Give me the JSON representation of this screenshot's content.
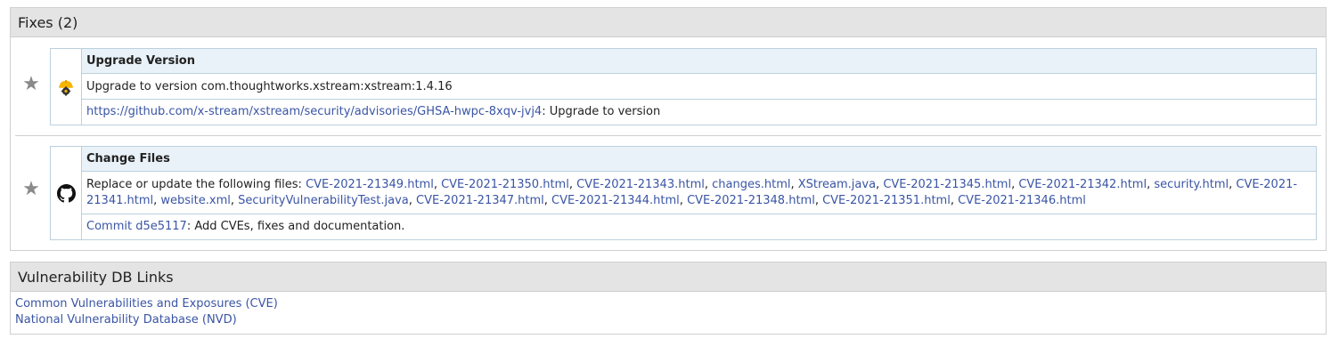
{
  "fixes": {
    "title": "Fixes (2)",
    "items": [
      {
        "icon": "upgrade-icon",
        "title": "Upgrade Version",
        "line1": "Upgrade to version com.thoughtworks.xstream:xstream:1.4.16",
        "link": "https://github.com/x-stream/xstream/security/advisories/GHSA-hwpc-8xqv-jvj4",
        "link_suffix": ": Upgrade to version"
      },
      {
        "icon": "github-icon",
        "title": "Change Files",
        "line1_prefix": "Replace or update the following files: ",
        "files": [
          "CVE-2021-21349.html",
          "CVE-2021-21350.html",
          "CVE-2021-21343.html",
          "changes.html",
          "XStream.java",
          "CVE-2021-21345.html",
          "CVE-2021-21342.html",
          "security.html",
          "CVE-2021-21341.html",
          "website.xml",
          "SecurityVulnerabilityTest.java",
          "CVE-2021-21347.html",
          "CVE-2021-21344.html",
          "CVE-2021-21348.html",
          "CVE-2021-21351.html",
          "CVE-2021-21346.html"
        ],
        "link": "Commit d5e5117",
        "link_suffix": ": Add CVEs, fixes and documentation."
      }
    ]
  },
  "vdb": {
    "title": "Vulnerability DB Links",
    "links": [
      "Common Vulnerabilities and Exposures (CVE)",
      "National Vulnerability Database (NVD)"
    ]
  },
  "colors": {
    "link": "#3a55a4",
    "header_bg": "#e4e4e4",
    "fix_title_bg": "#e9f2f8",
    "star": "#8a8a8a",
    "upgrade_icon": "#f5b400"
  }
}
